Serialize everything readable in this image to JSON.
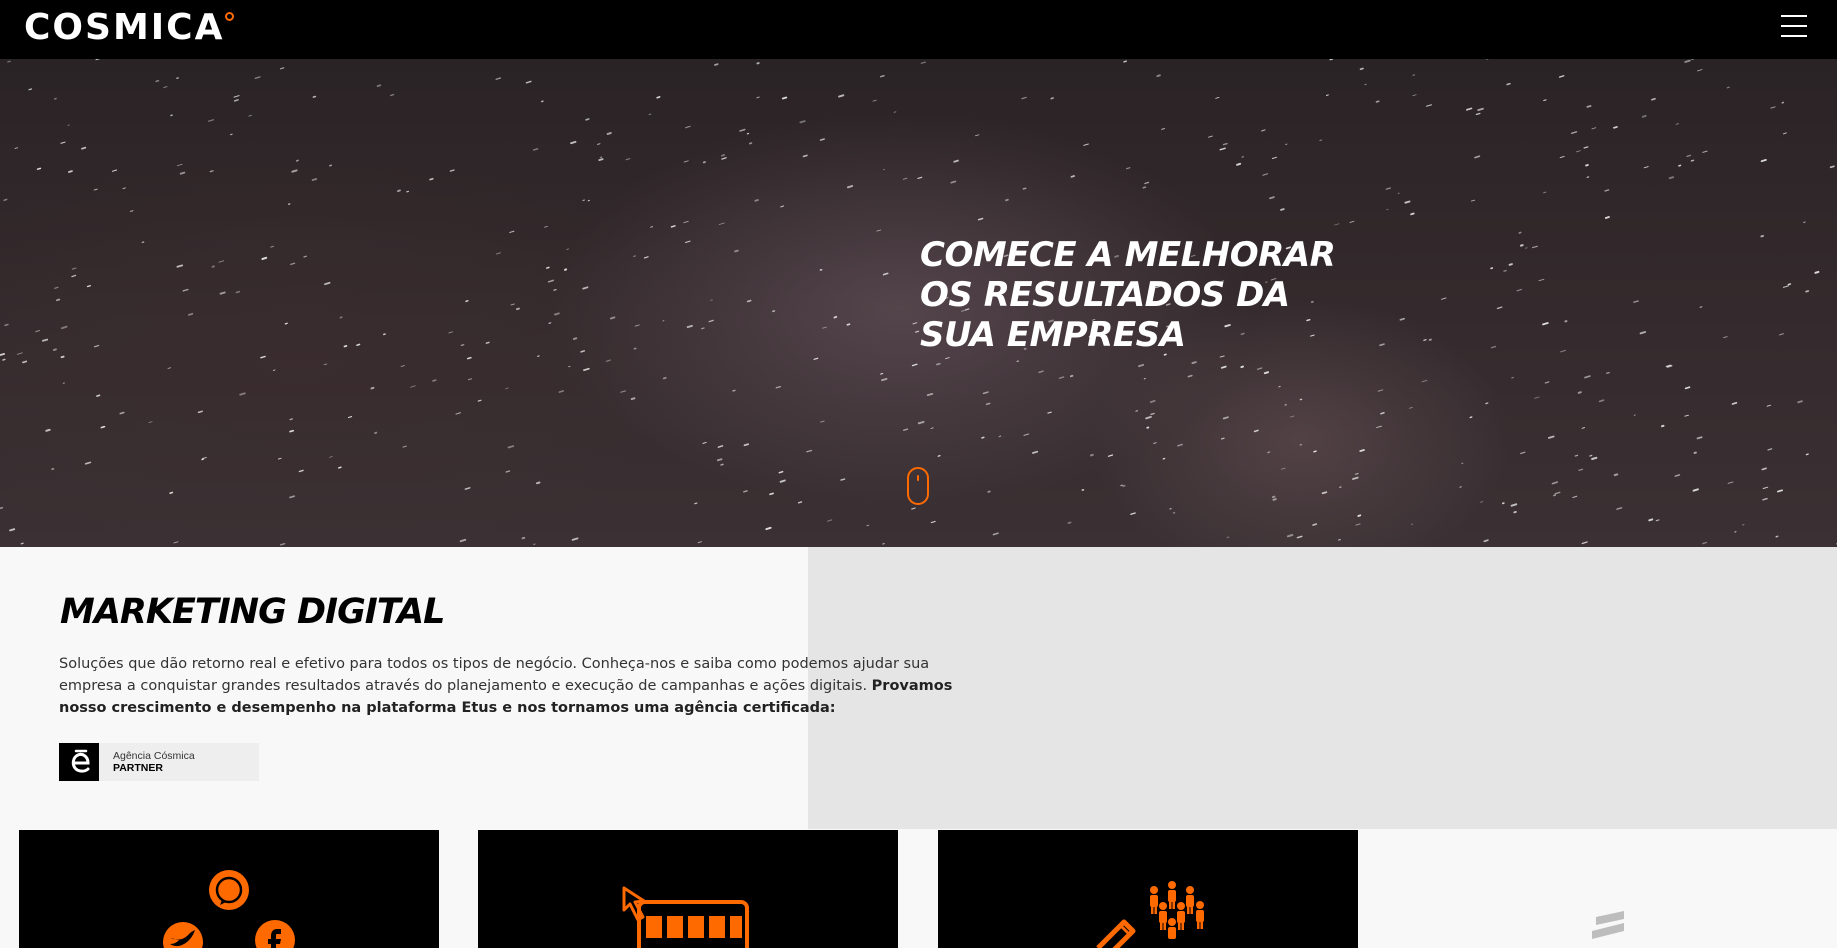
{
  "header": {
    "logo_text": "COSMICA",
    "menu_icon": "hamburger-menu-icon"
  },
  "hero": {
    "title_lines": [
      "COMECE A MELHORAR",
      "OS RESULTADOS DA",
      "SUA EMPRESA"
    ],
    "scroll_icon": "mouse-scroll-icon"
  },
  "marketing": {
    "title": "MARKETING DIGITAL",
    "description": "Soluções que dão retorno real e efetivo para todos os tipos de negócio. Conheça-nos e saiba como podemos ajudar sua empresa a conquistar grandes resultados através do planejamento e execução de campanhas e ações digitais. ",
    "description_bold": "Provamos nosso crescimento e desempenho na plataforma Etus e nos tornamos uma agência certificada:",
    "badge": {
      "line1": "Agência Cósmica",
      "line2": "PARTNER",
      "icon": "etus-logo-icon"
    }
  },
  "cards": [
    {
      "icon": "social-media-icons"
    },
    {
      "icon": "calendar-click-icon"
    },
    {
      "icon": "people-target-icon"
    }
  ],
  "colors": {
    "accent": "#ff6a00",
    "header_bg": "#000000",
    "card_bg": "#000000",
    "section_bg": "#f8f8f8",
    "section_right_bg": "#e5e5e5"
  }
}
